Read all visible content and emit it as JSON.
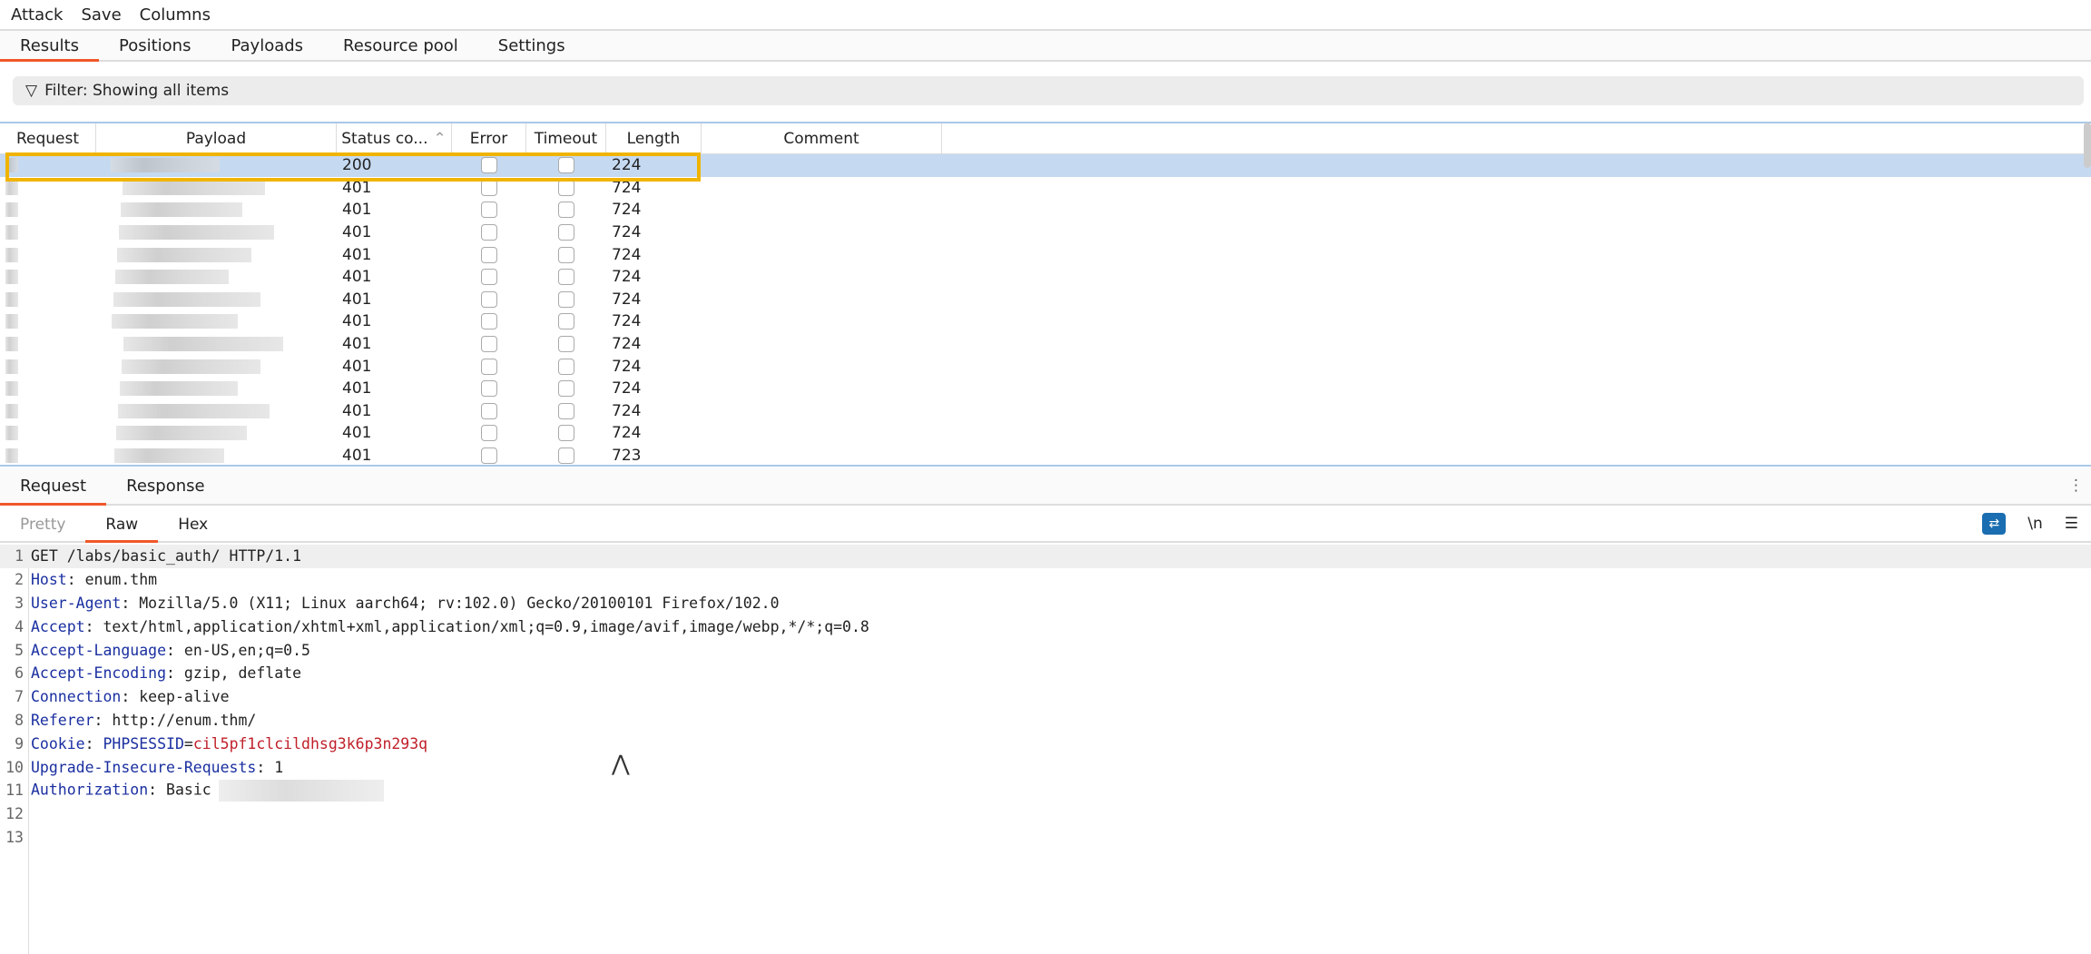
{
  "menu": [
    "Attack",
    "Save",
    "Columns"
  ],
  "tabs": [
    "Results",
    "Positions",
    "Payloads",
    "Resource pool",
    "Settings"
  ],
  "filter": "Filter: Showing all items",
  "columns": [
    "Request",
    "Payload",
    "Status co...",
    "Error",
    "Timeout",
    "Length",
    "Comment"
  ],
  "rows": [
    {
      "status": "200",
      "length": "224",
      "selected": true
    },
    {
      "status": "401",
      "length": "724"
    },
    {
      "status": "401",
      "length": "724"
    },
    {
      "status": "401",
      "length": "724"
    },
    {
      "status": "401",
      "length": "724"
    },
    {
      "status": "401",
      "length": "724"
    },
    {
      "status": "401",
      "length": "724"
    },
    {
      "status": "401",
      "length": "724"
    },
    {
      "status": "401",
      "length": "724"
    },
    {
      "status": "401",
      "length": "724"
    },
    {
      "status": "401",
      "length": "724"
    },
    {
      "status": "401",
      "length": "724"
    },
    {
      "status": "401",
      "length": "724"
    },
    {
      "status": "401",
      "length": "723"
    }
  ],
  "detail_tabs": [
    "Request",
    "Response"
  ],
  "view_tabs": [
    "Pretty",
    "Raw",
    "Hex"
  ],
  "newline_toggle": "\\n",
  "request_lines": [
    {
      "n": "1",
      "text": "GET /labs/basic_auth/ HTTP/1.1"
    },
    {
      "n": "2",
      "key": "Host",
      "val": "enum.thm"
    },
    {
      "n": "3",
      "key": "User-Agent",
      "val": "Mozilla/5.0 (X11; Linux aarch64; rv:102.0) Gecko/20100101 Firefox/102.0"
    },
    {
      "n": "4",
      "key": "Accept",
      "val": "text/html,application/xhtml+xml,application/xml;q=0.9,image/avif,image/webp,*/*;q=0.8"
    },
    {
      "n": "5",
      "key": "Accept-Language",
      "val": "en-US,en;q=0.5"
    },
    {
      "n": "6",
      "key": "Accept-Encoding",
      "val": "gzip, deflate"
    },
    {
      "n": "7",
      "key": "Connection",
      "val": "keep-alive"
    },
    {
      "n": "8",
      "key": "Referer",
      "val": "http://enum.thm/"
    },
    {
      "n": "9",
      "key": "Cookie",
      "cookie_name": "PHPSESSID",
      "cookie_val": "cil5pf1clcildhsg3k6p3n293q"
    },
    {
      "n": "10",
      "key": "Upgrade-Insecure-Requests",
      "val": "1"
    },
    {
      "n": "11",
      "key": "Authorization",
      "val": "Basic"
    },
    {
      "n": "12"
    },
    {
      "n": "13"
    }
  ]
}
